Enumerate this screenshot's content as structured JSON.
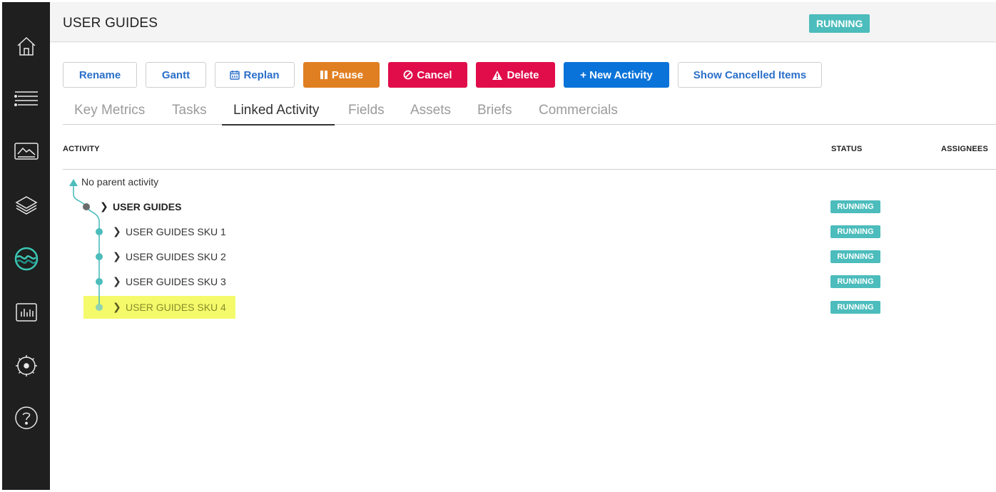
{
  "header": {
    "title": "USER GUIDES",
    "status": "RUNNING"
  },
  "sidebar": {
    "items": [
      {
        "icon": "home-icon"
      },
      {
        "icon": "list-icon"
      },
      {
        "icon": "media-icon"
      },
      {
        "icon": "layers-icon"
      },
      {
        "icon": "wave-logo-icon"
      },
      {
        "icon": "bar-chart-icon"
      },
      {
        "icon": "gear-icon"
      },
      {
        "icon": "help-icon"
      }
    ]
  },
  "toolbar": {
    "rename": "Rename",
    "gantt": "Gantt",
    "replan": "Replan",
    "pause": "Pause",
    "cancel": "Cancel",
    "delete": "Delete",
    "new_activity": "+ New Activity",
    "show_cancelled": "Show Cancelled Items"
  },
  "tabs": [
    {
      "label": "Key Metrics"
    },
    {
      "label": "Tasks"
    },
    {
      "label": "Linked Activity",
      "active": true
    },
    {
      "label": "Fields"
    },
    {
      "label": "Assets"
    },
    {
      "label": "Briefs"
    },
    {
      "label": "Commercials"
    }
  ],
  "table": {
    "columns": {
      "activity": "ACTIVITY",
      "status": "STATUS",
      "assignees": "ASSIGNEES"
    },
    "no_parent": "No parent activity",
    "rows": [
      {
        "label": "USER GUIDES",
        "status": "RUNNING"
      },
      {
        "label": "USER GUIDES SKU 1",
        "status": "RUNNING"
      },
      {
        "label": "USER GUIDES SKU 2",
        "status": "RUNNING"
      },
      {
        "label": "USER GUIDES SKU 3",
        "status": "RUNNING"
      },
      {
        "label": "USER GUIDES SKU 4",
        "status": "RUNNING",
        "highlighted": true
      }
    ]
  },
  "colors": {
    "accent_teal": "#4cbcbc",
    "pause": "#e07f22",
    "danger": "#e00d4a",
    "primary": "#0a73d9",
    "highlight": "#f4fa6a"
  }
}
